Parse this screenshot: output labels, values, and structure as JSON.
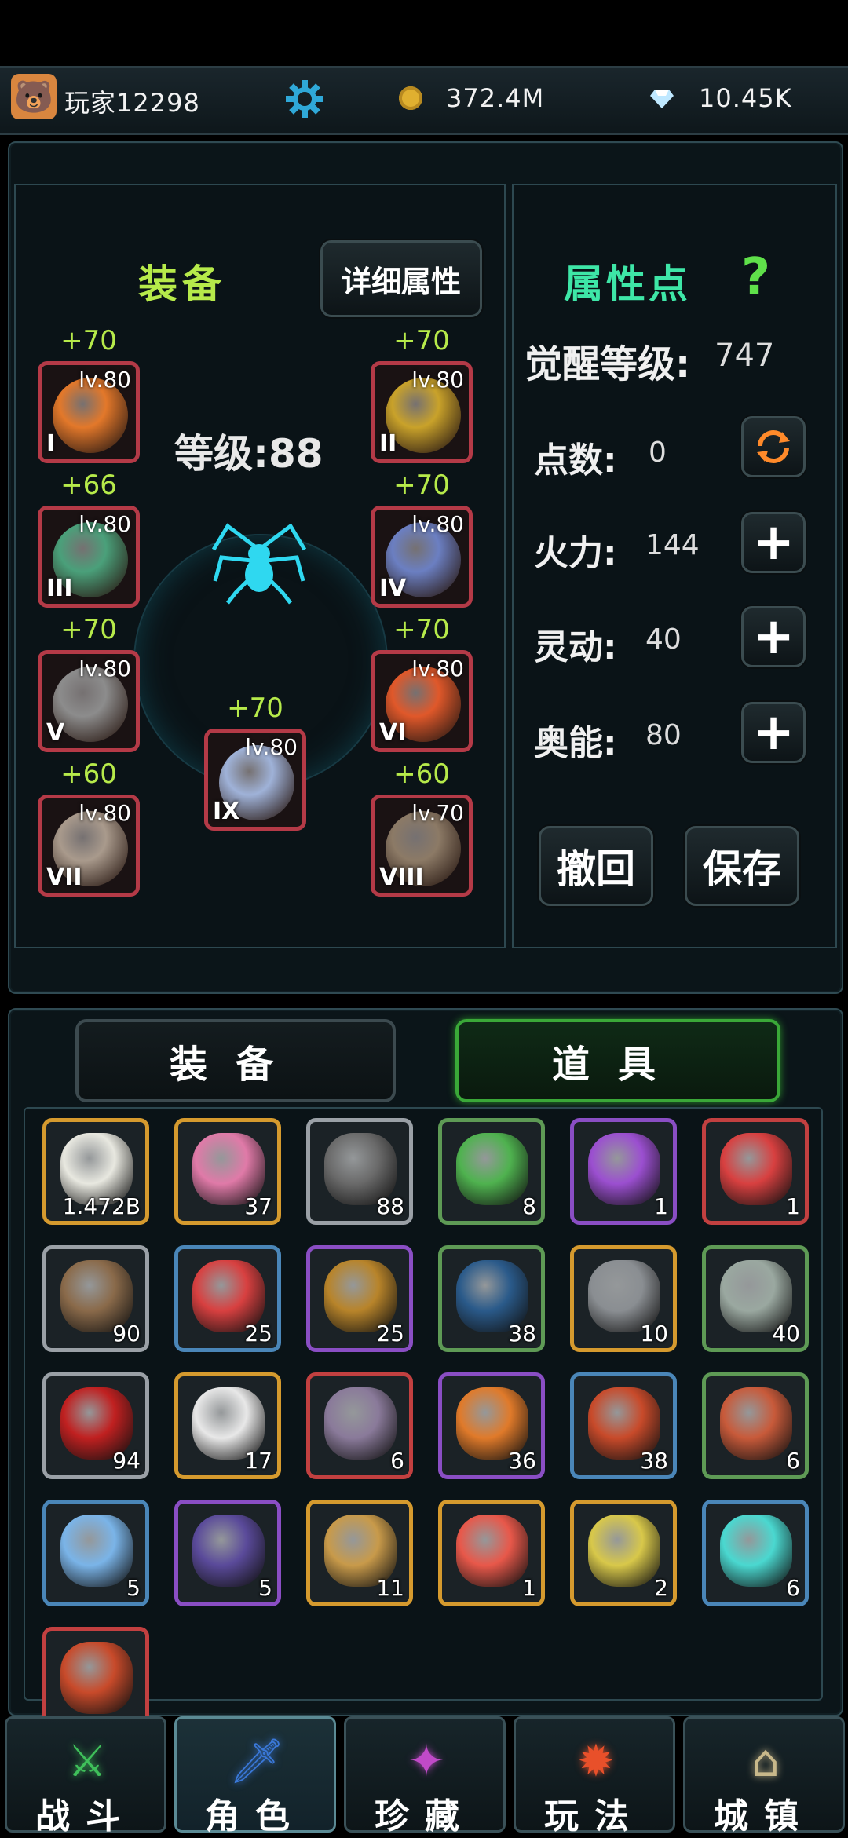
{
  "topbar": {
    "player_name": "玩家12298",
    "gold": "372.4M",
    "gems": "10.45K"
  },
  "equipment_panel": {
    "title": "装备",
    "detail_button": "详细属性",
    "level_label": "等级:88",
    "slots": [
      {
        "roman": "I",
        "level": "lv.80",
        "bonus": "+70",
        "color": "#e3782a"
      },
      {
        "roman": "II",
        "level": "lv.80",
        "bonus": "+70",
        "color": "#c9a22a"
      },
      {
        "roman": "III",
        "level": "lv.80",
        "bonus": "+66",
        "color": "#4aa07a"
      },
      {
        "roman": "IV",
        "level": "lv.80",
        "bonus": "+70",
        "color": "#6b7fc2"
      },
      {
        "roman": "V",
        "level": "lv.80",
        "bonus": "+70",
        "color": "#8c8c8c"
      },
      {
        "roman": "VI",
        "level": "lv.80",
        "bonus": "+70",
        "color": "#e0582a"
      },
      {
        "roman": "VII",
        "level": "lv.80",
        "bonus": "+60",
        "color": "#a99a8c"
      },
      {
        "roman": "VIII",
        "level": "lv.70",
        "bonus": "+60",
        "color": "#8c7a66"
      },
      {
        "roman": "IX",
        "level": "lv.80",
        "bonus": "+70",
        "color": "#9fb2d8"
      }
    ]
  },
  "attributes_panel": {
    "title": "属性点",
    "help_icon": "?",
    "awaken_label": "觉醒等级:",
    "awaken_value": "747",
    "points": {
      "label": "点数:",
      "value": "0"
    },
    "stats": [
      {
        "label": "火力:",
        "value": "144"
      },
      {
        "label": "灵动:",
        "value": "40"
      },
      {
        "label": "奥能:",
        "value": "80"
      }
    ],
    "undo_button": "撤回",
    "save_button": "保存"
  },
  "inventory_tabs": {
    "equipment": "装备",
    "items": "道具"
  },
  "inventory": [
    {
      "count": "1.472B",
      "border": "#d59a2e",
      "color": "#e8e8e0"
    },
    {
      "count": "37",
      "border": "#d59a2e",
      "color": "#e07aa8"
    },
    {
      "count": "88",
      "border": "#9aa0a6",
      "color": "#6a6a6a"
    },
    {
      "count": "8",
      "border": "#5e9a55",
      "color": "#4fb24f"
    },
    {
      "count": "1",
      "border": "#8a4ec4",
      "color": "#9b4fd0"
    },
    {
      "count": "1",
      "border": "#c24040",
      "color": "#d84040"
    },
    {
      "count": "90",
      "border": "#9aa0a6",
      "color": "#8a6a4a"
    },
    {
      "count": "25",
      "border": "#4a86b8",
      "color": "#d84040"
    },
    {
      "count": "25",
      "border": "#8a4ec4",
      "color": "#b8842a"
    },
    {
      "count": "38",
      "border": "#5e9a55",
      "color": "#2a5a8a"
    },
    {
      "count": "10",
      "border": "#d59a2e",
      "color": "#8a8e92"
    },
    {
      "count": "40",
      "border": "#5e9a55",
      "color": "#9aa8a0"
    },
    {
      "count": "94",
      "border": "#9aa0a6",
      "color": "#c02020"
    },
    {
      "count": "17",
      "border": "#d59a2e",
      "color": "#e8e8e8"
    },
    {
      "count": "6",
      "border": "#c24040",
      "color": "#8a7a9a"
    },
    {
      "count": "36",
      "border": "#8a4ec4",
      "color": "#e07a2a"
    },
    {
      "count": "38",
      "border": "#4a86b8",
      "color": "#c84a2a"
    },
    {
      "count": "6",
      "border": "#5e9a55",
      "color": "#c85a3a"
    },
    {
      "count": "5",
      "border": "#4a86b8",
      "color": "#7ab4e8"
    },
    {
      "count": "5",
      "border": "#8a4ec4",
      "color": "#5a4a9a"
    },
    {
      "count": "11",
      "border": "#d59a2e",
      "color": "#c89a4a"
    },
    {
      "count": "1",
      "border": "#d59a2e",
      "color": "#e8584a"
    },
    {
      "count": "2",
      "border": "#d59a2e",
      "color": "#d8c84a"
    },
    {
      "count": "6",
      "border": "#4a86b8",
      "color": "#4ad8d0"
    },
    {
      "count": "",
      "border": "#c24040",
      "color": "#c84a2a"
    }
  ],
  "bottom_nav": [
    {
      "label": "战斗",
      "icon": "crossed-swords-icon",
      "color": "#3fbf5a"
    },
    {
      "label": "角色",
      "icon": "sword-emblem-icon",
      "color": "#3a78d8"
    },
    {
      "label": "珍藏",
      "icon": "treasure-icon",
      "color": "#c04ac8"
    },
    {
      "label": "玩法",
      "icon": "fire-emblem-icon",
      "color": "#e8502a"
    },
    {
      "label": "城镇",
      "icon": "town-icon",
      "color": "#c8b88a"
    }
  ]
}
